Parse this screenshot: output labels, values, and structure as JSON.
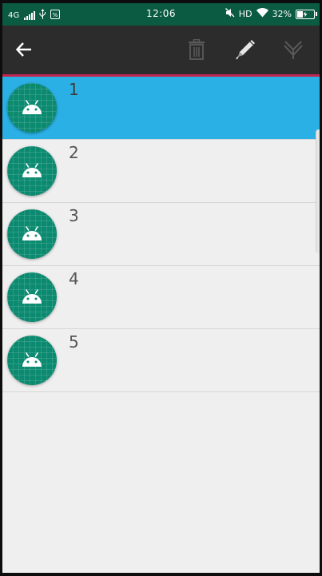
{
  "status_bar": {
    "network": "4G",
    "time": "12:06",
    "hd": "HD",
    "battery_text": "32%",
    "battery_level": 0.32,
    "icons": [
      "signal-icon",
      "usb-icon",
      "notification-app-icon",
      "mute-icon",
      "wifi-icon",
      "battery-icon"
    ]
  },
  "toolbar": {
    "back_icon": "arrow-left-icon",
    "delete_icon": "trash-icon",
    "edit_icon": "pencil-icon",
    "select_icon": "select-all-icon"
  },
  "list": {
    "items": [
      {
        "label": "1",
        "icon": "android-icon",
        "selected": true
      },
      {
        "label": "2",
        "icon": "android-icon",
        "selected": false
      },
      {
        "label": "3",
        "icon": "android-icon",
        "selected": false
      },
      {
        "label": "4",
        "icon": "android-icon",
        "selected": false
      },
      {
        "label": "5",
        "icon": "android-icon",
        "selected": false
      }
    ]
  },
  "colors": {
    "status_bar": "#0b5a42",
    "toolbar": "#2c2c2c",
    "toolbar_accent_line": "#c0264f",
    "selected_row": "#2bb0e5",
    "avatar": "#0b8a70",
    "background": "#efefef"
  }
}
